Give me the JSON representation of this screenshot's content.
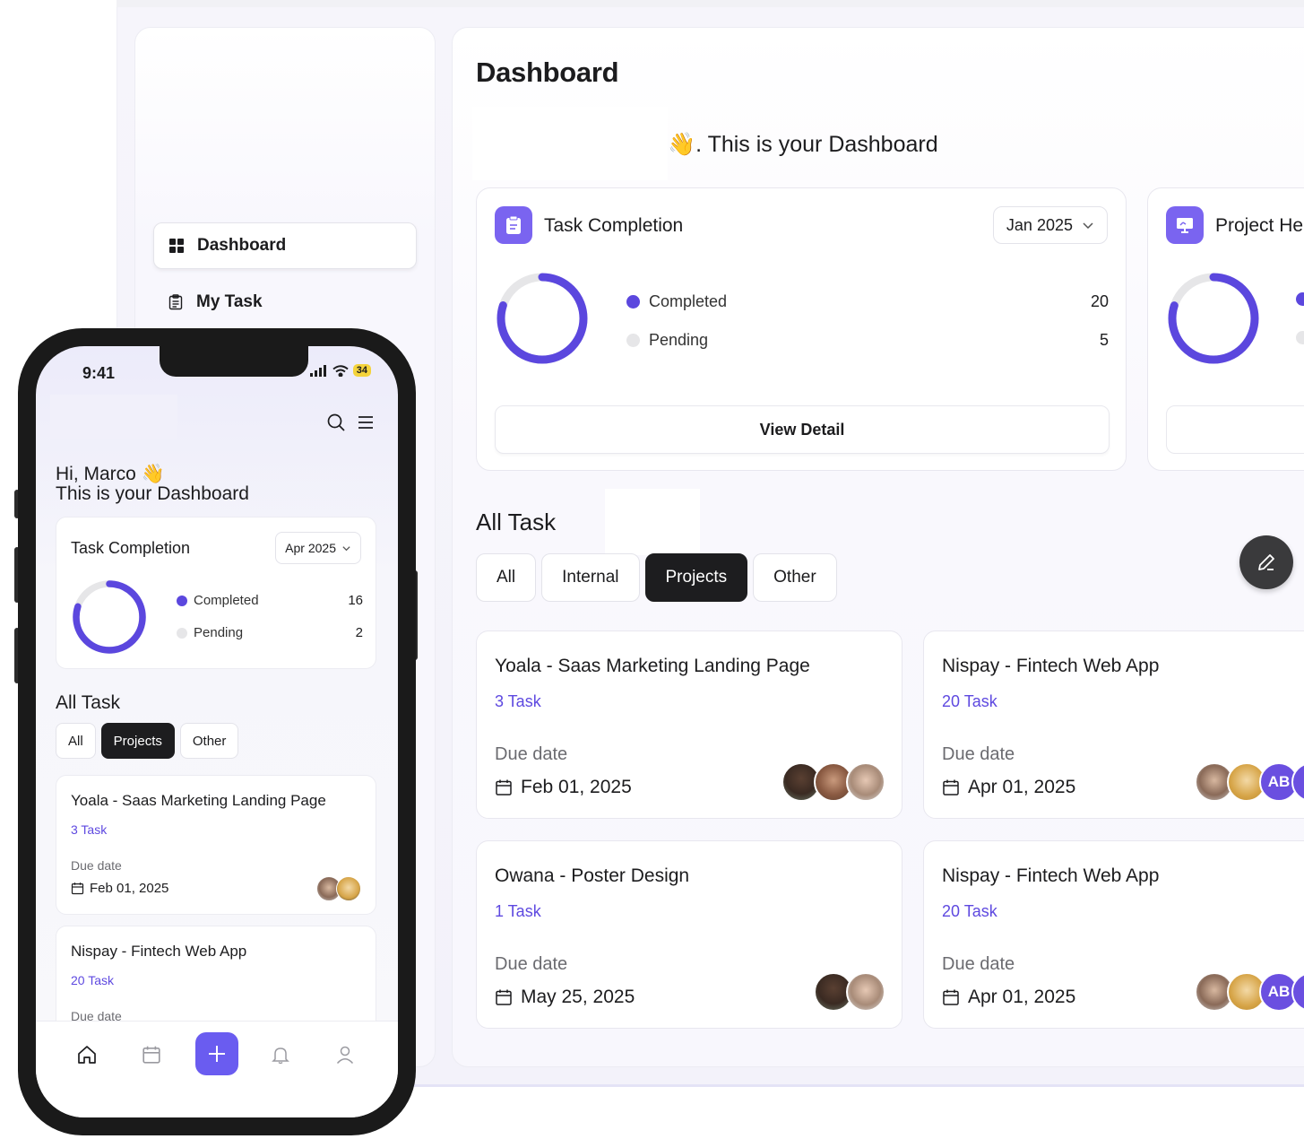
{
  "sidebar": {
    "items": [
      {
        "label": "Dashboard",
        "icon": "grid-icon"
      },
      {
        "label": "My Task",
        "icon": "clipboard-icon"
      }
    ]
  },
  "main": {
    "title": "Dashboard",
    "welcome": "👋. This is your Dashboard",
    "task_completion": {
      "title": "Task Completion",
      "month": "Jan 2025",
      "legend": [
        {
          "label": "Completed",
          "value": "20",
          "color": "#5b47de"
        },
        {
          "label": "Pending",
          "value": "5",
          "color": "#e6e6e8"
        }
      ],
      "completed_fraction": 0.8,
      "view_detail": "View Detail"
    },
    "project_health": {
      "title": "Project He"
    },
    "all_task": {
      "title": "All Task",
      "tabs": [
        "All",
        "Internal",
        "Projects",
        "Other"
      ],
      "active_tab": "Projects",
      "due_label": "Due date",
      "tasks": [
        {
          "name": "Yoala - Saas Marketing Landing Page",
          "count": "3 Task",
          "date": "Feb 01, 2025"
        },
        {
          "name": "Nispay - Fintech Web App",
          "count": "20 Task",
          "date": "Apr 01, 2025",
          "initials": "AB"
        },
        {
          "name": "Owana - Poster Design",
          "count": "1 Task",
          "date": "May 25, 2025"
        },
        {
          "name": "Nispay - Fintech Web App",
          "count": "20 Task",
          "date": "Apr 01, 2025",
          "initials": "AB"
        }
      ]
    }
  },
  "mobile": {
    "time": "9:41",
    "battery": "34",
    "greeting_line1": "Hi, Marco 👋",
    "greeting_line2": "This is your Dashboard",
    "task_completion": {
      "title": "Task Completion",
      "month": "Apr 2025",
      "legend": [
        {
          "label": "Completed",
          "value": "16"
        },
        {
          "label": "Pending",
          "value": "2"
        }
      ],
      "completed_fraction": 0.8
    },
    "all_task": {
      "title": "All Task",
      "tabs": [
        "All",
        "Projects",
        "Other"
      ],
      "active_tab": "Projects",
      "due_label": "Due date",
      "tasks": [
        {
          "name": "Yoala - Saas Marketing Landing Page",
          "count": "3 Task",
          "date": "Feb 01, 2025"
        },
        {
          "name": "Nispay - Fintech Web App",
          "count": "20 Task"
        }
      ]
    },
    "nav_icons": [
      "home-icon",
      "calendar-icon",
      "plus-icon",
      "bell-icon",
      "user-icon"
    ]
  },
  "colors": {
    "accent": "#6a5cf0",
    "accent_text": "#5e49e0",
    "dark_tab": "#1d1d1f"
  }
}
